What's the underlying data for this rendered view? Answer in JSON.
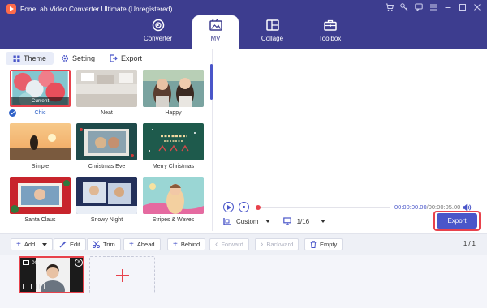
{
  "app": {
    "title": "FoneLab Video Converter Ultimate (Unregistered)"
  },
  "nav": [
    {
      "label": "Converter",
      "icon": "converter-icon"
    },
    {
      "label": "MV",
      "icon": "mv-icon"
    },
    {
      "label": "Collage",
      "icon": "collage-icon"
    },
    {
      "label": "Toolbox",
      "icon": "toolbox-icon"
    }
  ],
  "active_nav": "MV",
  "subtabs": [
    {
      "label": "Theme",
      "icon": "grid-icon"
    },
    {
      "label": "Setting",
      "icon": "gear-icon"
    },
    {
      "label": "Export",
      "icon": "export-icon"
    }
  ],
  "themes": [
    {
      "label": "Chic",
      "selected": true,
      "badge": "Current"
    },
    {
      "label": "Neat"
    },
    {
      "label": "Happy"
    },
    {
      "label": "Simple"
    },
    {
      "label": "Christmas Eve"
    },
    {
      "label": "Merry Christmas"
    },
    {
      "label": "Santa Claus"
    },
    {
      "label": "Snowy Night"
    },
    {
      "label": "Stripes & Waves"
    }
  ],
  "player": {
    "current_time": "00:00:00.00",
    "total_time": "00:00:05.00",
    "ratio": "Custom",
    "page": "1/16",
    "progress": 0
  },
  "export_button": "Export",
  "toolbar": {
    "add": "Add",
    "edit": "Edit",
    "trim": "Trim",
    "ahead": "Ahead",
    "behind": "Behind",
    "forward": "Forward",
    "backward": "Backward",
    "empty": "Empty",
    "pager_current": "1",
    "pager_total": "1"
  },
  "clip": {
    "duration": "00:"
  },
  "colors": {
    "header": "#3d3d8f",
    "accent": "#4a56c9",
    "highlight": "#e8424c"
  }
}
